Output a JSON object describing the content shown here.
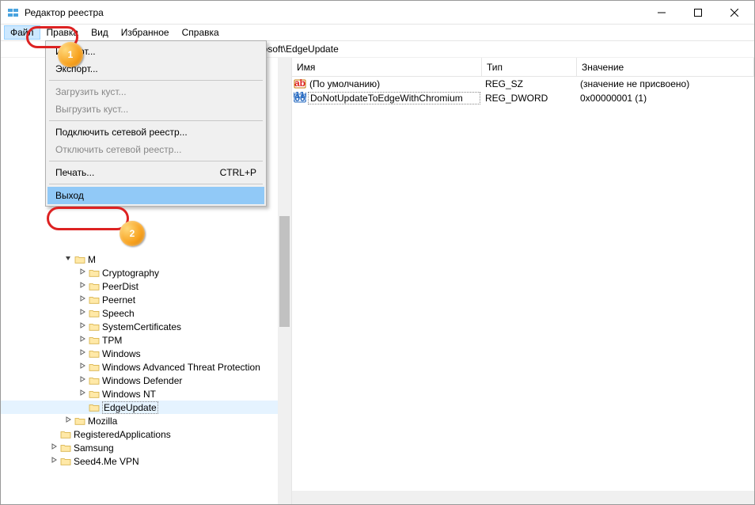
{
  "window": {
    "title": "Редактор реестра"
  },
  "menubar": {
    "items": [
      {
        "label": "Файл",
        "active": true
      },
      {
        "label": "Правка"
      },
      {
        "label": "Вид"
      },
      {
        "label": "Избранное"
      },
      {
        "label": "Справка"
      }
    ]
  },
  "addressbar": {
    "text": "ties\\Microsoft\\EdgeUpdate"
  },
  "dropdown": {
    "items": [
      {
        "label": "Импорт...",
        "type": "item"
      },
      {
        "label": "Экспорт...",
        "type": "item"
      },
      {
        "type": "sep"
      },
      {
        "label": "Загрузить куст...",
        "type": "item",
        "disabled": true
      },
      {
        "label": "Выгрузить куст...",
        "type": "item",
        "disabled": true
      },
      {
        "type": "sep"
      },
      {
        "label": "Подключить сетевой реестр...",
        "type": "item"
      },
      {
        "label": "Отключить сетевой реестр...",
        "type": "item",
        "disabled": true
      },
      {
        "type": "sep"
      },
      {
        "label": "Печать...",
        "shortcut": "CTRL+P",
        "type": "item"
      },
      {
        "type": "sep"
      },
      {
        "label": "Выход",
        "type": "item",
        "highlighted": true
      }
    ]
  },
  "columns": {
    "name": "Имя",
    "type": "Тип",
    "value": "Значение"
  },
  "values": [
    {
      "icon": "ab",
      "name": "(По умолчанию)",
      "type": "REG_SZ",
      "value": "(значение не присвоено)",
      "selected": false
    },
    {
      "icon": "bin",
      "name": "DoNotUpdateToEdgeWithChromium",
      "type": "REG_DWORD",
      "value": "0x00000001 (1)",
      "selected": true
    }
  ],
  "tree": [
    {
      "indent": 4,
      "exp": "v",
      "label": "M",
      "partial": true
    },
    {
      "indent": 5,
      "exp": ">",
      "label": "Cryptography"
    },
    {
      "indent": 5,
      "exp": ">",
      "label": "PeerDist"
    },
    {
      "indent": 5,
      "exp": ">",
      "label": "Peernet"
    },
    {
      "indent": 5,
      "exp": ">",
      "label": "Speech"
    },
    {
      "indent": 5,
      "exp": ">",
      "label": "SystemCertificates"
    },
    {
      "indent": 5,
      "exp": ">",
      "label": "TPM"
    },
    {
      "indent": 5,
      "exp": ">",
      "label": "Windows"
    },
    {
      "indent": 5,
      "exp": ">",
      "label": "Windows Advanced Threat Protection"
    },
    {
      "indent": 5,
      "exp": ">",
      "label": "Windows Defender"
    },
    {
      "indent": 5,
      "exp": ">",
      "label": "Windows NT"
    },
    {
      "indent": 5,
      "exp": "",
      "label": "EdgeUpdate",
      "selected": true
    },
    {
      "indent": 4,
      "exp": ">",
      "label": "Mozilla"
    },
    {
      "indent": 3,
      "exp": "",
      "label": "RegisteredApplications"
    },
    {
      "indent": 3,
      "exp": ">",
      "label": "Samsung"
    },
    {
      "indent": 3,
      "exp": ">",
      "label": "Seed4.Me VPN"
    }
  ],
  "badges": {
    "one": "1",
    "two": "2"
  }
}
